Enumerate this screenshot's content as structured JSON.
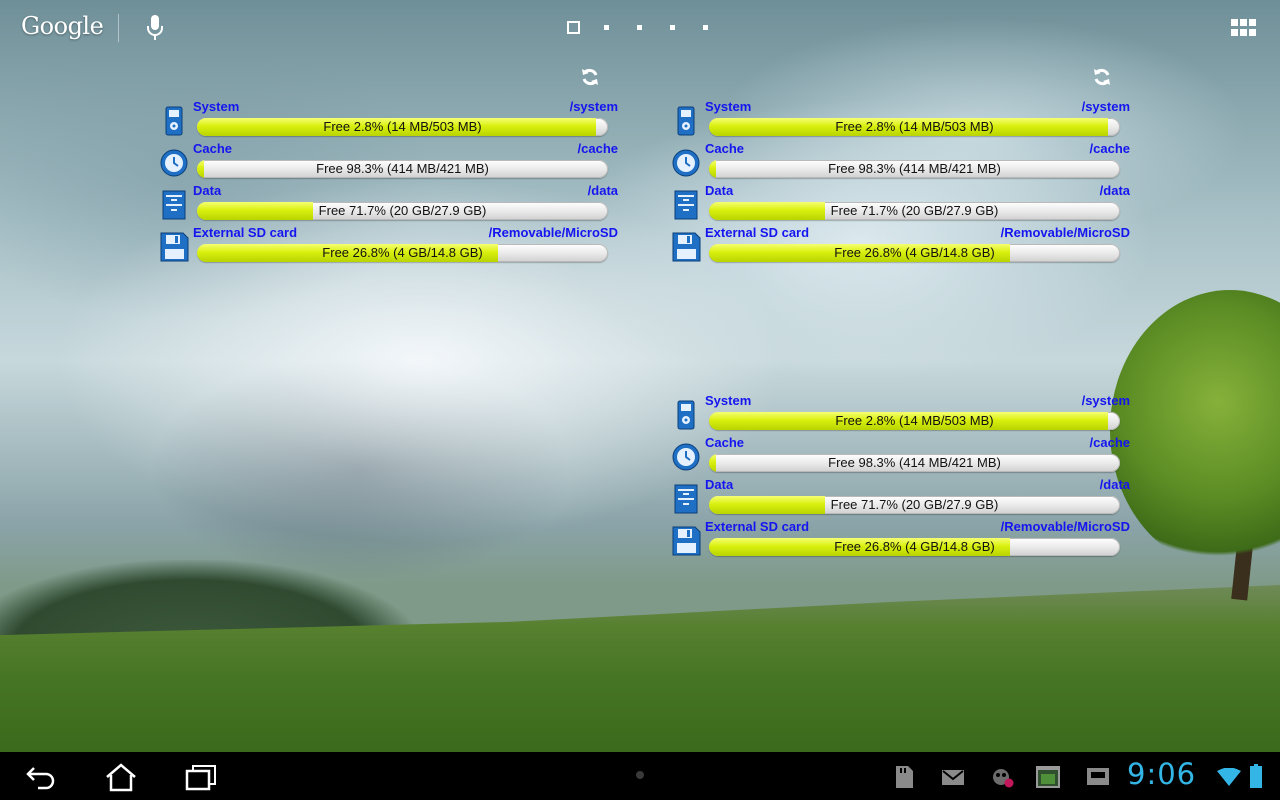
{
  "topbar": {
    "search_logo": "Google",
    "page_count": 5,
    "current_page": 1
  },
  "widgets": [
    {
      "show_refresh": true,
      "rows": [
        {
          "icon": "system-icon",
          "label": "System",
          "path": "/system",
          "free_text": "Free 2.8% (14 MB/503 MB)",
          "fill_fraction": 0.972
        },
        {
          "icon": "cache-clock-icon",
          "label": "Cache",
          "path": "/cache",
          "free_text": "Free 98.3% (414 MB/421 MB)",
          "fill_fraction": 0.017
        },
        {
          "icon": "data-cabinet-icon",
          "label": "Data",
          "path": "/data",
          "free_text": "Free 71.7% (20 GB/27.9 GB)",
          "fill_fraction": 0.283
        },
        {
          "icon": "floppy-disk-icon",
          "label": "External SD card",
          "path": "/Removable/MicroSD",
          "free_text": "Free 26.8% (4 GB/14.8 GB)",
          "fill_fraction": 0.732
        }
      ]
    },
    {
      "show_refresh": true,
      "rows": [
        {
          "icon": "system-icon",
          "label": "System",
          "path": "/system",
          "free_text": "Free 2.8% (14 MB/503 MB)",
          "fill_fraction": 0.972
        },
        {
          "icon": "cache-clock-icon",
          "label": "Cache",
          "path": "/cache",
          "free_text": "Free 98.3% (414 MB/421 MB)",
          "fill_fraction": 0.017
        },
        {
          "icon": "data-cabinet-icon",
          "label": "Data",
          "path": "/data",
          "free_text": "Free 71.7% (20 GB/27.9 GB)",
          "fill_fraction": 0.283
        },
        {
          "icon": "floppy-disk-icon",
          "label": "External SD card",
          "path": "/Removable/MicroSD",
          "free_text": "Free 26.8% (4 GB/14.8 GB)",
          "fill_fraction": 0.732
        }
      ]
    },
    {
      "show_refresh": false,
      "rows": [
        {
          "icon": "system-icon",
          "label": "System",
          "path": "/system",
          "free_text": "Free 2.8% (14 MB/503 MB)",
          "fill_fraction": 0.972
        },
        {
          "icon": "cache-clock-icon",
          "label": "Cache",
          "path": "/cache",
          "free_text": "Free 98.3% (414 MB/421 MB)",
          "fill_fraction": 0.017
        },
        {
          "icon": "data-cabinet-icon",
          "label": "Data",
          "path": "/data",
          "free_text": "Free 71.7% (20 GB/27.9 GB)",
          "fill_fraction": 0.283
        },
        {
          "icon": "floppy-disk-icon",
          "label": "External SD card",
          "path": "/Removable/MicroSD",
          "free_text": "Free 26.8% (4 GB/14.8 GB)",
          "fill_fraction": 0.732
        }
      ]
    }
  ],
  "navbar": {
    "buttons": [
      "back-icon",
      "home-icon",
      "recent-apps-icon"
    ],
    "notifications": [
      "sd-card-icon",
      "gmail-icon",
      "app-update-icon",
      "screenshot-icon",
      "storage-device-icon"
    ],
    "time": "9:06"
  },
  "colors": {
    "label_text": "#1515f0",
    "bar_fill": "#d9f00f",
    "clock": "#33b5e5",
    "navbar_bg": "#000000"
  }
}
